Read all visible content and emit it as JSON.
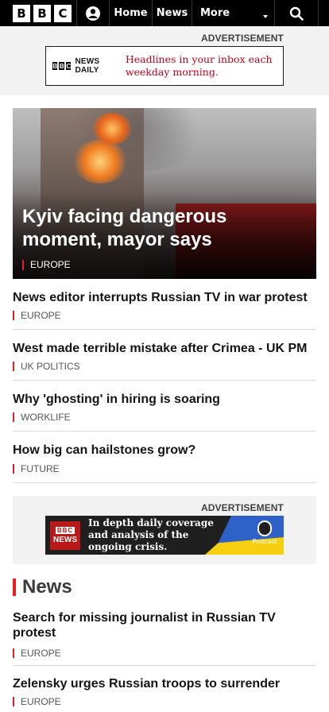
{
  "nav": {
    "logo_letters": [
      "B",
      "B",
      "C"
    ],
    "items": [
      {
        "label": "Home"
      },
      {
        "label": "News"
      },
      {
        "label": "More"
      }
    ]
  },
  "ads": {
    "top": {
      "label": "ADVERTISEMENT",
      "brand": "NEWS DAILY",
      "text": "Headlines in your inbox each weekday morning."
    },
    "mid": {
      "label": "ADVERTISEMENT",
      "brand_small": "BBC",
      "brand": "NEWS",
      "text": "In depth daily coverage and analysis of the ongoing crisis.",
      "podcast": "Podcast"
    }
  },
  "hero": {
    "title": "Kyiv facing dangerous moment, mayor says",
    "tag": "EUROPE"
  },
  "stories": [
    {
      "title": "News editor interrupts Russian TV in war protest",
      "tag": "EUROPE"
    },
    {
      "title": "West made terrible mistake after Crimea - UK PM",
      "tag": "UK POLITICS"
    },
    {
      "title": "Why 'ghosting' in hiring is soaring",
      "tag": "WORKLIFE"
    },
    {
      "title": "How big can hailstones grow?",
      "tag": "FUTURE"
    }
  ],
  "news_section": {
    "heading": "News",
    "stories": [
      {
        "title": "Search for missing journalist in Russian TV protest",
        "tag": "EUROPE"
      },
      {
        "title": "Zelensky urges Russian troops to surrender",
        "tag": "EUROPE"
      }
    ]
  }
}
